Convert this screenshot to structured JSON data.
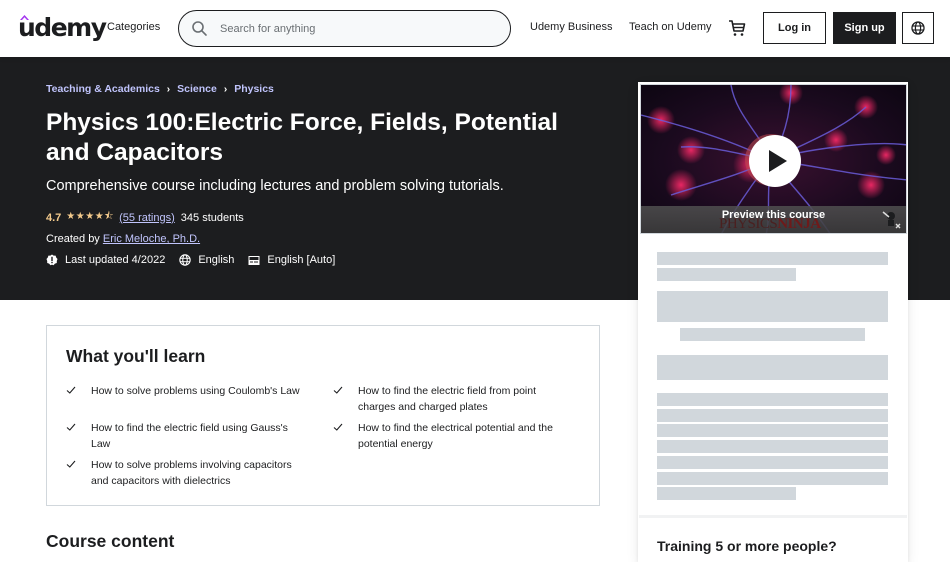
{
  "header": {
    "logo_text": "udemy",
    "categories": "Categories",
    "search_placeholder": "Search for anything",
    "udemy_business": "Udemy Business",
    "teach": "Teach on Udemy",
    "login": "Log in",
    "signup": "Sign up"
  },
  "colors": {
    "brand_purple": "#a435f0",
    "dark_bg": "#1c1d1f",
    "link_purple": "#c0c4fc",
    "star_gold": "#f3ca8c",
    "skeleton": "#d1d7dc"
  },
  "hero": {
    "breadcrumb": [
      "Teaching & Academics",
      "Science",
      "Physics"
    ],
    "title": "Physics 100:Electric Force, Fields, Potential and Capacitors",
    "subtitle": "Comprehensive course including lectures and problem solving tutorials.",
    "rating": "4.7",
    "stars": "★★★★⯪",
    "ratings_link": "(55 ratings)",
    "students": "345 students",
    "created_by_label": "Created by",
    "instructor": "Eric Meloche, Ph.D.",
    "last_updated": "Last updated 4/2022",
    "language": "English",
    "captions": "English [Auto]"
  },
  "card": {
    "preview_label": "Preview this course",
    "watermark_a": "PHYSICS",
    "watermark_b": "NINJA",
    "training_title": "Training 5 or more people?"
  },
  "learn": {
    "title": "What you'll learn",
    "items": [
      "How to solve problems using Coulomb's Law",
      "How to find the electric field from point charges and charged plates",
      "How to find the electric field using Gauss's Law",
      "How to find the electrical potential and the potential energy",
      "How to solve problems involving capacitors and capacitors with dielectrics"
    ]
  },
  "course_content": {
    "title": "Course content"
  }
}
